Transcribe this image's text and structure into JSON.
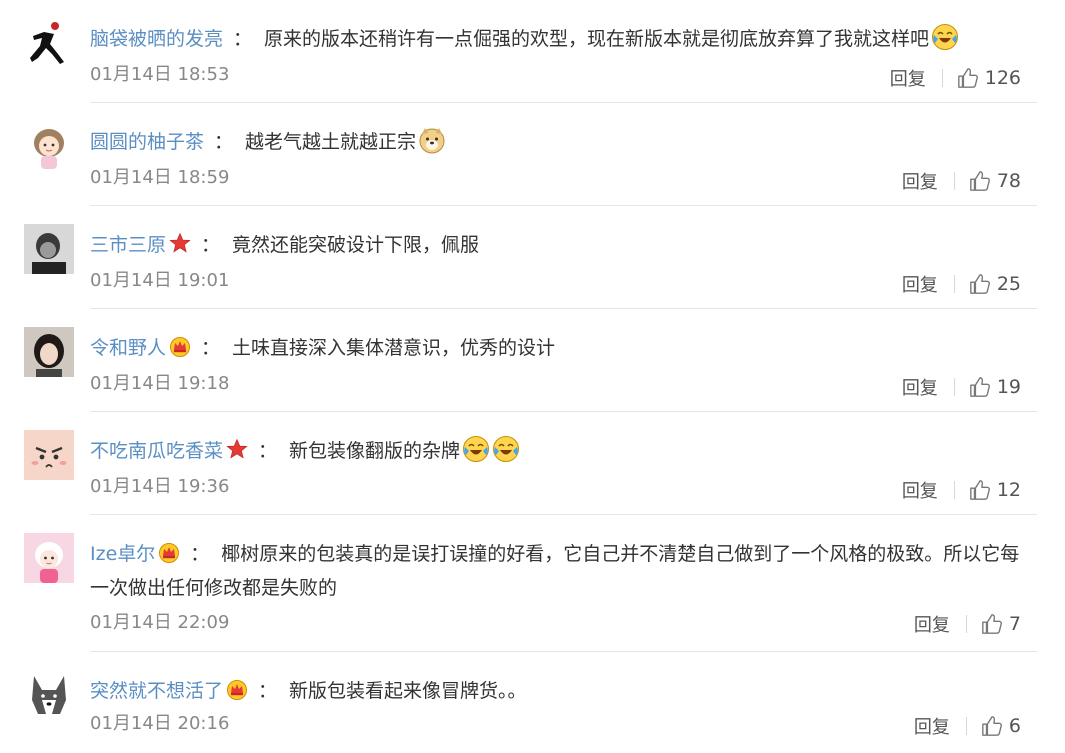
{
  "ui": {
    "reply_label": "回复",
    "colon": "："
  },
  "icons": {
    "like": "thumbs-up-icon",
    "badge_red": "red-star-icon",
    "badge_crown": "crown-icon",
    "emoji_laugh": "laughing-crying-emoji",
    "emoji_doge": "doge-emoji"
  },
  "colors": {
    "username": "#5b8fc4",
    "text": "#333333",
    "time": "#888888",
    "divider": "#e6e6e6"
  },
  "comments": [
    {
      "user": "脑袋被晒的发亮",
      "text": "原来的版本还稍许有一点倔强的欢型，现在新版本就是彻底放弃算了我就这样吧",
      "time": "01月14日 18:53",
      "likes": "126"
    },
    {
      "user": "圆圆的柚子茶",
      "text": "越老气越土就越正宗",
      "time": "01月14日 18:59",
      "likes": "78"
    },
    {
      "user": "三市三原",
      "text": "竟然还能突破设计下限，佩服",
      "time": "01月14日 19:01",
      "likes": "25"
    },
    {
      "user": "令和野人",
      "text": "土味直接深入集体潜意识，优秀的设计",
      "time": "01月14日 19:18",
      "likes": "19"
    },
    {
      "user": "不吃南瓜吃香菜",
      "text": "新包装像翻版的杂牌",
      "time": "01月14日 19:36",
      "likes": "12"
    },
    {
      "user": "Ize卓尔",
      "text": "椰树原来的包装真的是误打误撞的好看，它自己并不清楚自己做到了一个风格的极致。所以它每一次做出任何修改都是失败的",
      "time": "01月14日 22:09",
      "likes": "7"
    },
    {
      "user": "突然就不想活了",
      "text": "新版包装看起来像冒牌货。。",
      "time": "01月14日 20:16",
      "likes": "6"
    }
  ]
}
